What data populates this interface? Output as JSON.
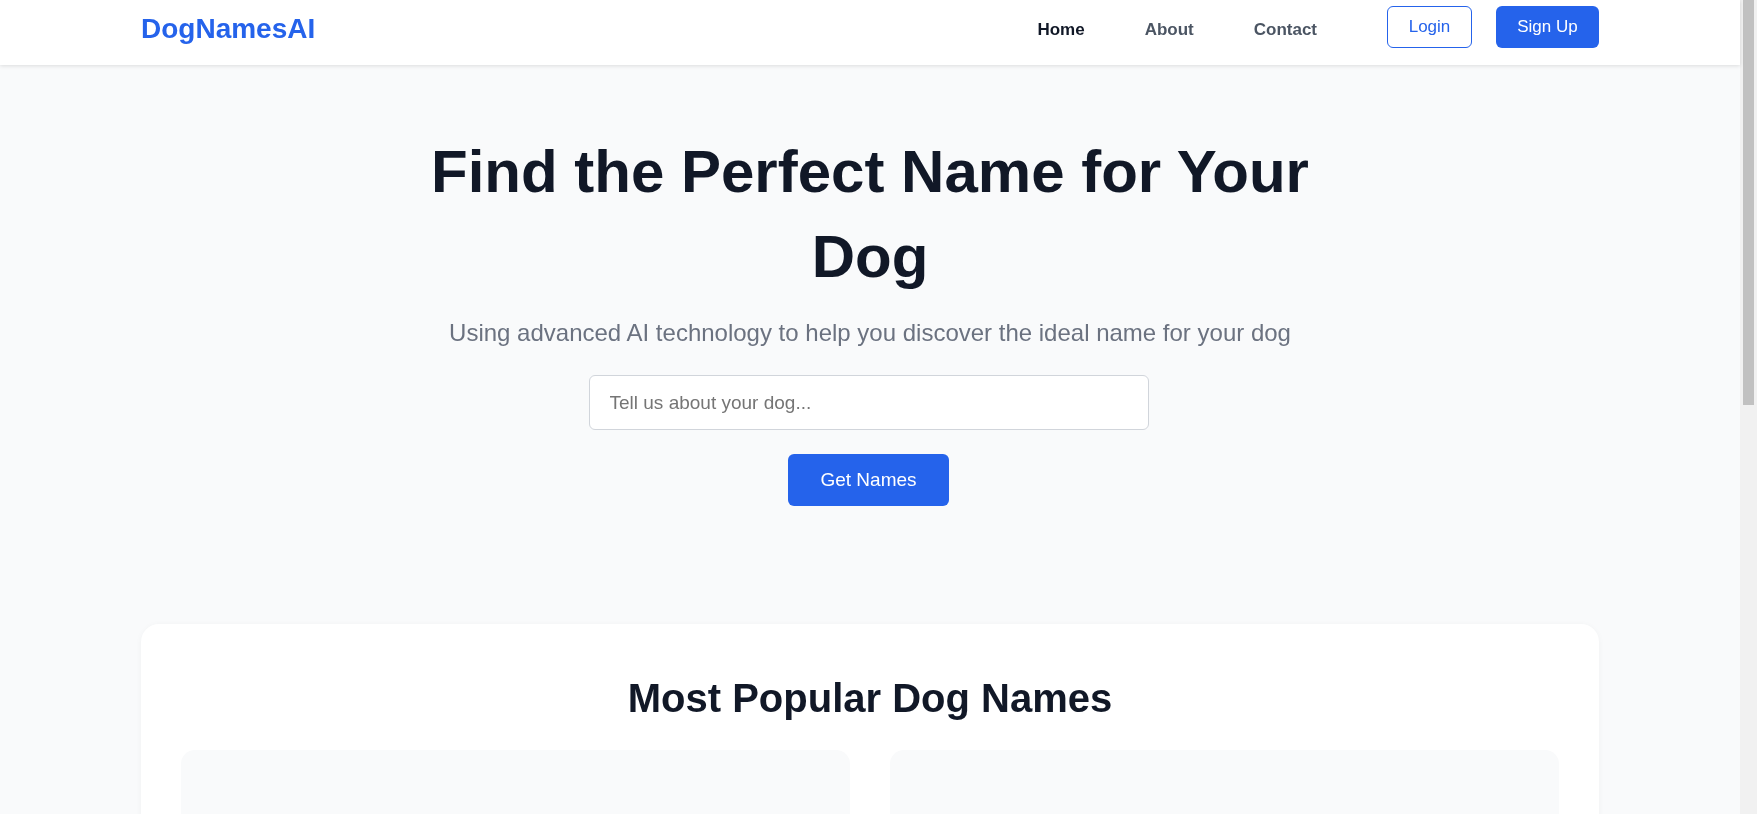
{
  "navbar": {
    "brand": "DogNamesAI",
    "links": [
      {
        "label": "Home",
        "selected": true
      },
      {
        "label": "About",
        "selected": false
      },
      {
        "label": "Contact",
        "selected": false
      }
    ],
    "login": "Login",
    "signup": "Sign Up"
  },
  "hero": {
    "title": "Find the Perfect Name for Your Dog",
    "subtitle": "Using advanced AI technology to help you discover the ideal name for your dog",
    "search": {
      "placeholder": "Tell us about your dog..."
    },
    "button": "Get Names"
  },
  "popular": {
    "title": "Most Popular Dog Names"
  }
}
